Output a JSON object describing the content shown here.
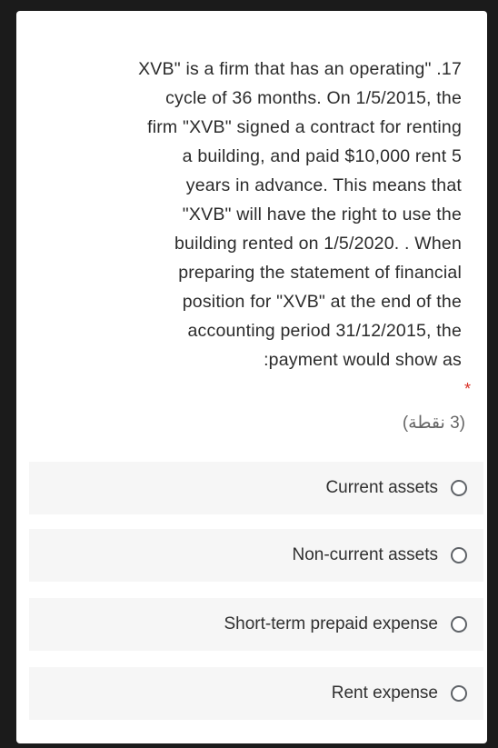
{
  "question": {
    "text": "XVB\" is a firm that has an operating\" .17\ncycle of 36 months. On 1/5/2015, the\nfirm \"XVB\" signed a contract for renting\na building, and paid $10,000 rent 5\nyears in advance. This means that\n\"XVB\" will have the right to use the\nbuilding rented on 1/5/2020. . When\npreparing the statement of financial\nposition for \"XVB\" at the end of the\naccounting period 31/12/2015, the\n:payment would show as",
    "required_mark": "*",
    "points": "(3 نقطة)"
  },
  "options": [
    {
      "label": "Current assets"
    },
    {
      "label": "Non-current assets"
    },
    {
      "label": "Short-term prepaid expense"
    },
    {
      "label": "Rent expense"
    }
  ],
  "colors": {
    "background": "#1b1b1b",
    "card": "#ffffff",
    "option_bg": "#f6f6f6",
    "text": "#2b2b2b",
    "required": "#d93025"
  }
}
